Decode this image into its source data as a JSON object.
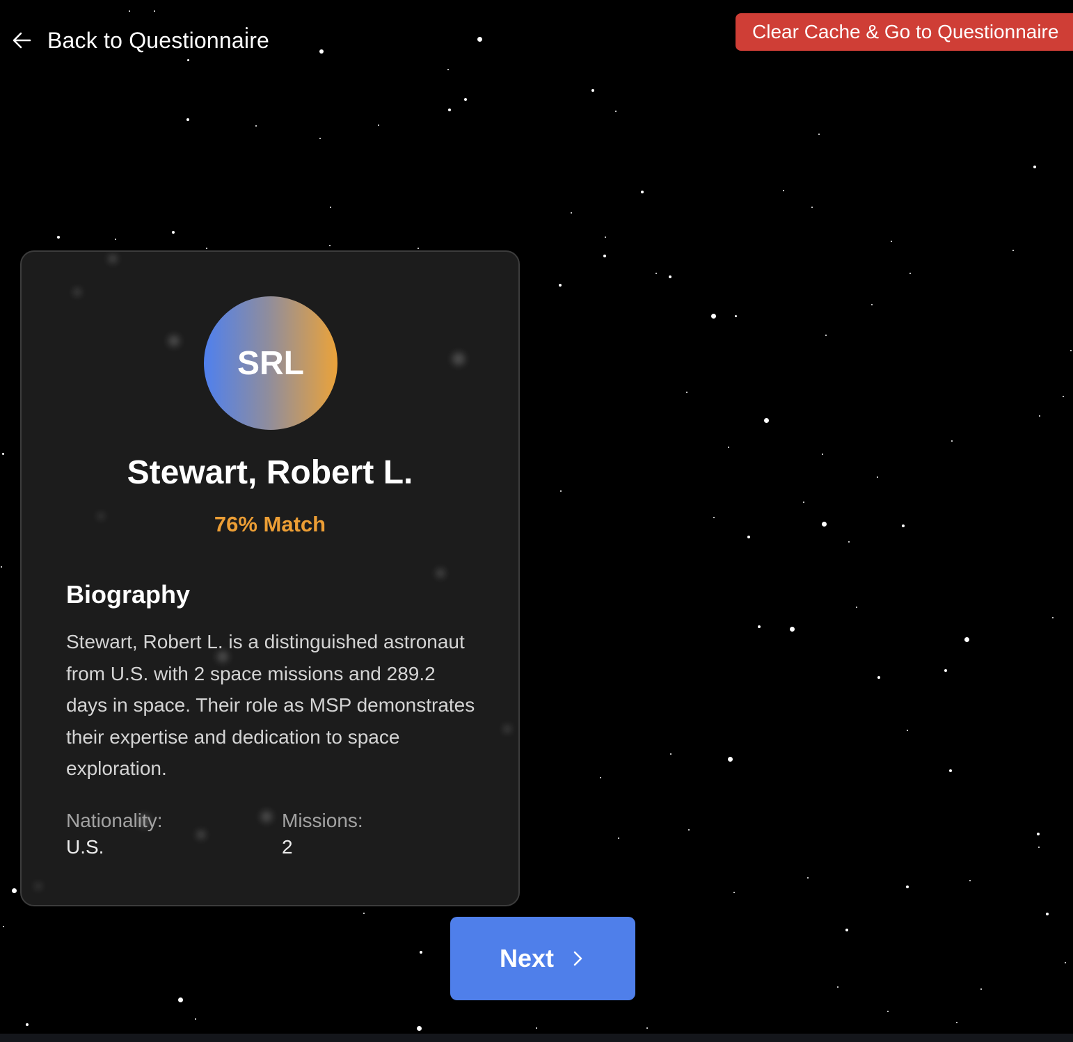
{
  "header": {
    "back_label": "Back to Questionnaire",
    "back_icon": "arrow-left-icon",
    "clear_cache_label": "Clear Cache & Go to Questionnaire"
  },
  "profile": {
    "initials": "SRL",
    "name": "Stewart, Robert L.",
    "match": "76% Match",
    "biography_heading": "Biography",
    "biography": "Stewart, Robert L. is a distinguished astronaut from U.S. with 2 space missions and 289.2 days in space. Their role as MSP demonstrates their expertise and dedication to space exploration.",
    "nationality_label": "Nationality:",
    "nationality": "U.S.",
    "missions_label": "Missions:",
    "missions": "2"
  },
  "navigation": {
    "next_label": "Next",
    "next_icon": "chevron-right-icon"
  },
  "colors": {
    "background": "#000000",
    "card": "#1e1e1e",
    "clear_button": "#cf3e36",
    "next_button": "#4f7fea",
    "match_text": "#ec9e35",
    "avatar_gradient_start": "#4f80ee",
    "avatar_gradient_end": "#eba33a"
  }
}
